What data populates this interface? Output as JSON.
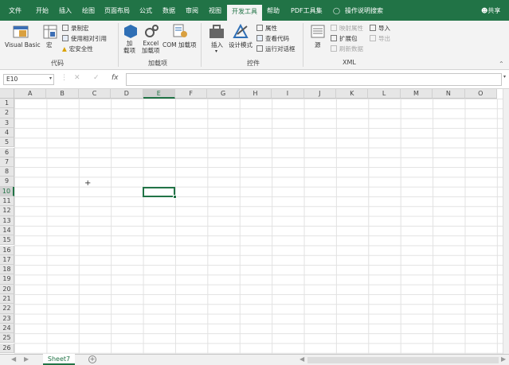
{
  "tabs": [
    "文件",
    "开始",
    "插入",
    "绘图",
    "页面布局",
    "公式",
    "数据",
    "审阅",
    "视图",
    "开发工具",
    "帮助",
    "PDF工具集"
  ],
  "active_tab": "开发工具",
  "tell_me": "操作说明搜索",
  "share": "共享",
  "ribbon": {
    "code": {
      "label": "代码",
      "visual_basic": "Visual Basic",
      "macros": "宏",
      "record_macro": "录制宏",
      "relative_refs": "使用相对引用",
      "macro_security": "宏安全性"
    },
    "addins": {
      "label": "加载项",
      "addins_btn": "加\n载项",
      "excel_addins": "Excel\n加载项",
      "com_addins": "COM 加载项"
    },
    "controls": {
      "label": "控件",
      "insert": "插入",
      "design_mode": "设计模式",
      "properties": "属性",
      "view_code": "查看代码",
      "run_dialog": "运行对话框"
    },
    "xml": {
      "label": "XML",
      "source": "源",
      "map_properties": "映射属性",
      "expansion_packs": "扩展包",
      "refresh_data": "刷新数据",
      "import": "导入",
      "export": "导出"
    }
  },
  "formula_bar": {
    "name_box": "E10",
    "formula": "",
    "fx": "fx"
  },
  "columns": [
    "A",
    "B",
    "C",
    "D",
    "E",
    "F",
    "G",
    "H",
    "I",
    "J",
    "K",
    "L",
    "M",
    "N",
    "O"
  ],
  "rows": [
    "1",
    "2",
    "3",
    "4",
    "5",
    "6",
    "7",
    "8",
    "9",
    "10",
    "11",
    "12",
    "13",
    "14",
    "15",
    "16",
    "17",
    "18",
    "19",
    "20",
    "21",
    "22",
    "23",
    "24",
    "25",
    "26"
  ],
  "selected_cell": "E10",
  "sheet_tab": "Sheet7",
  "colors": {
    "accent": "#217346"
  }
}
